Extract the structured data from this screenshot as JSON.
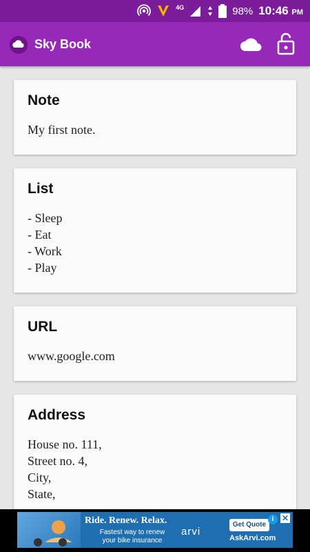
{
  "status_bar": {
    "network": "4G",
    "battery": "98%",
    "time": "10:46",
    "ampm": "PM",
    "icons": [
      "hotspot-icon",
      "v-app-icon",
      "signal-icon",
      "battery-icon"
    ]
  },
  "app_bar": {
    "title": "Sky Book",
    "icons": [
      "app-logo-icon",
      "cloud-icon",
      "lock-icon"
    ]
  },
  "cards": [
    {
      "title": "Note",
      "lines": [
        "My first note."
      ]
    },
    {
      "title": "List",
      "lines": [
        "- Sleep",
        "- Eat",
        "- Work",
        "- Play"
      ]
    },
    {
      "title": "URL",
      "lines": [
        "www.google.com"
      ]
    },
    {
      "title": "Address",
      "lines": [
        "House no. 111,",
        "Street no. 4,",
        "City,",
        "State,"
      ]
    }
  ],
  "ad": {
    "headline": "Ride. Renew. Relax.",
    "sub_line1": "Fastest way to renew",
    "sub_line2": "your bike insurance",
    "brand": "arvi",
    "cta": "Get Quote",
    "domain": "AskArvi.com",
    "info": "i",
    "close": "✕"
  },
  "colors": {
    "status_bar": "#7b1c9a",
    "app_bar": "#9728b8",
    "background": "#e6e6e6",
    "card": "#fafafa"
  }
}
